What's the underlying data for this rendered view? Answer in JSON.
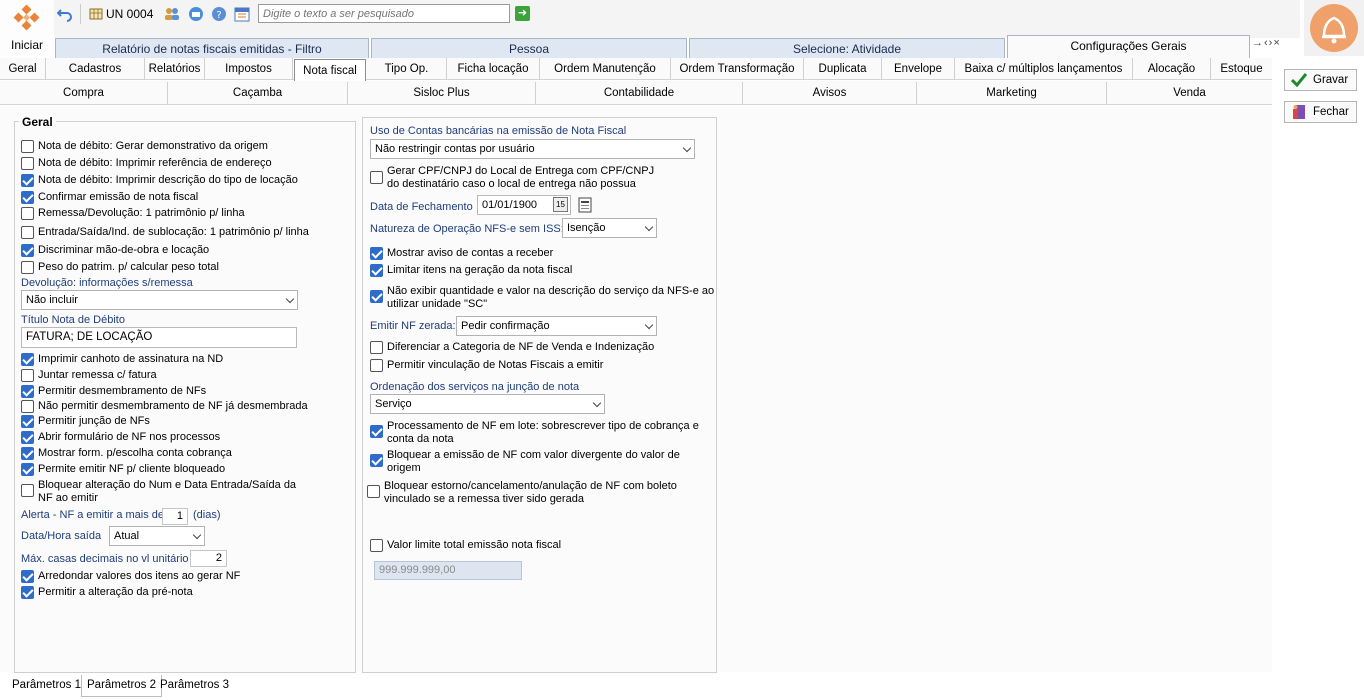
{
  "toolbar": {
    "home_label": "Iniciar",
    "unit_label": "UN 0004",
    "search_placeholder": "Digite o texto a ser pesquisado"
  },
  "window_tabs": [
    {
      "label": "Relatório de notas fiscais emitidas - Filtro"
    },
    {
      "label": "Pessoa"
    },
    {
      "label": "Selecione: Atividade"
    },
    {
      "label": "Configurações Gerais"
    }
  ],
  "tab_nav": {
    "label": "→‹›×"
  },
  "config_tabs_row1": [
    "Geral",
    "Cadastros",
    "Relatórios",
    "Impostos",
    "Nota fiscal",
    "Tipo Op.",
    "Ficha locação",
    "Ordem Manutenção",
    "Ordem Transformação",
    "Duplicata",
    "Envelope",
    "Baixa c/ múltiplos lançamentos",
    "Alocação",
    "Estoque"
  ],
  "config_tabs_row2": [
    "Compra",
    "Caçamba",
    "Sisloc Plus",
    "Contabilidade",
    "Avisos",
    "Marketing",
    "Venda"
  ],
  "side_buttons": {
    "save": "Gravar",
    "close": "Fechar"
  },
  "left_panel": {
    "title": "Geral",
    "checks_a": [
      {
        "label": "Nota de débito: Gerar demonstrativo da origem",
        "checked": false
      },
      {
        "label": "Nota de débito: Imprimir referência de endereço",
        "checked": false
      },
      {
        "label": "Nota de débito: Imprimir descrição do tipo de locação",
        "checked": true
      },
      {
        "label": "Confirmar emissão de nota fiscal",
        "checked": true
      },
      {
        "label": "Remessa/Devolução: 1 patrimônio p/ linha",
        "checked": false
      },
      {
        "label": "Entrada/Saída/Ind. de sublocação: 1 patrimônio p/ linha",
        "checked": false
      },
      {
        "label": "Discriminar mão-de-obra e locação",
        "checked": true
      },
      {
        "label": "Peso do patrim. p/ calcular peso total",
        "checked": false
      }
    ],
    "devolucao_label": "Devolução: informações s/remessa",
    "devolucao_value": "Não incluir",
    "titulo_label": "Título Nota de Débito",
    "titulo_value": "FATURA; DE LOCAÇÃO",
    "checks_b": [
      {
        "label": "Imprimir canhoto de assinatura na ND",
        "checked": true
      },
      {
        "label": "Juntar remessa c/ fatura",
        "checked": false
      },
      {
        "label": "Permitir desmembramento de NFs",
        "checked": true
      },
      {
        "label": "Não permitir desmembramento de NF já desmembrada",
        "checked": false
      },
      {
        "label": "Permitir junção de NFs",
        "checked": true
      },
      {
        "label": "Abrir formulário de NF nos processos",
        "checked": true
      },
      {
        "label": "Mostrar form. p/escolha conta cobrança",
        "checked": true
      },
      {
        "label": "Permite emitir NF p/ cliente bloqueado",
        "checked": true
      }
    ],
    "bloquear_label_1": "Bloquear alteração do Num e Data Entrada/Saída da",
    "bloquear_label_2": "NF ao emitir",
    "alerta_label": "Alerta - NF a emitir a mais de",
    "alerta_value": "1",
    "alerta_unit": "(dias)",
    "datahora_label": "Data/Hora saída",
    "datahora_value": "Atual",
    "decimais_label": "Máx. casas decimais no vl unitário",
    "decimais_value": "2",
    "checks_c": [
      {
        "label": "Arredondar valores dos itens ao gerar NF",
        "checked": true
      },
      {
        "label": "Permitir a alteração da pré-nota",
        "checked": true
      }
    ]
  },
  "mid_panel": {
    "contas_label": "Uso de Contas bancárias na emissão de Nota Fiscal",
    "contas_value": "Não restringir contas por usuário",
    "gerar_cpf_1": "Gerar CPF/CNPJ do Local de Entrega com CPF/CNPJ",
    "gerar_cpf_2": "do destinatário caso o local de entrega não possua",
    "fechamento_label": "Data de Fechamento",
    "fechamento_value": "01/01/1900",
    "natureza_label": "Natureza de Operação NFS-e sem ISS:",
    "natureza_value": "Isenção",
    "checks_a": [
      {
        "label": "Mostrar aviso de contas a receber",
        "checked": true
      },
      {
        "label": "Limitar itens na geração da nota fiscal",
        "checked": true
      }
    ],
    "nao_exibir_1": "Não exibir quantidade e valor na descrição do serviço da NFS-e ao",
    "nao_exibir_2": "utilizar unidade \"SC\"",
    "emitir_zerada_label": "Emitir NF zerada:",
    "emitir_zerada_value": "Pedir confirmação",
    "checks_b": [
      {
        "label": "Diferenciar a Categoria de NF de Venda e Indenização",
        "checked": false
      },
      {
        "label": "Permitir vinculação de Notas Fiscais a emitir",
        "checked": false
      }
    ],
    "ordenacao_label": "Ordenação dos serviços na junção de nota",
    "ordenacao_value": "Serviço",
    "processamento_1": "Processamento de NF em lote: sobrescrever tipo de cobrança e",
    "processamento_2": "conta da nota",
    "bloquear_emissao_1": "Bloquear a emissão de NF com valor divergente do valor de",
    "bloquear_emissao_2": "origem",
    "bloquear_estorno_1": "Bloquear estorno/cancelamento/anulação de NF com boleto",
    "bloquear_estorno_2": "vinculado se a remessa tiver sido gerada",
    "valor_limite_label": "Valor limite total emissão nota fiscal",
    "valor_limite_value": "999.999.999,00"
  },
  "bottom_tabs": [
    "Parâmetros 1",
    "Parâmetros 2",
    "Parâmetros 3"
  ]
}
